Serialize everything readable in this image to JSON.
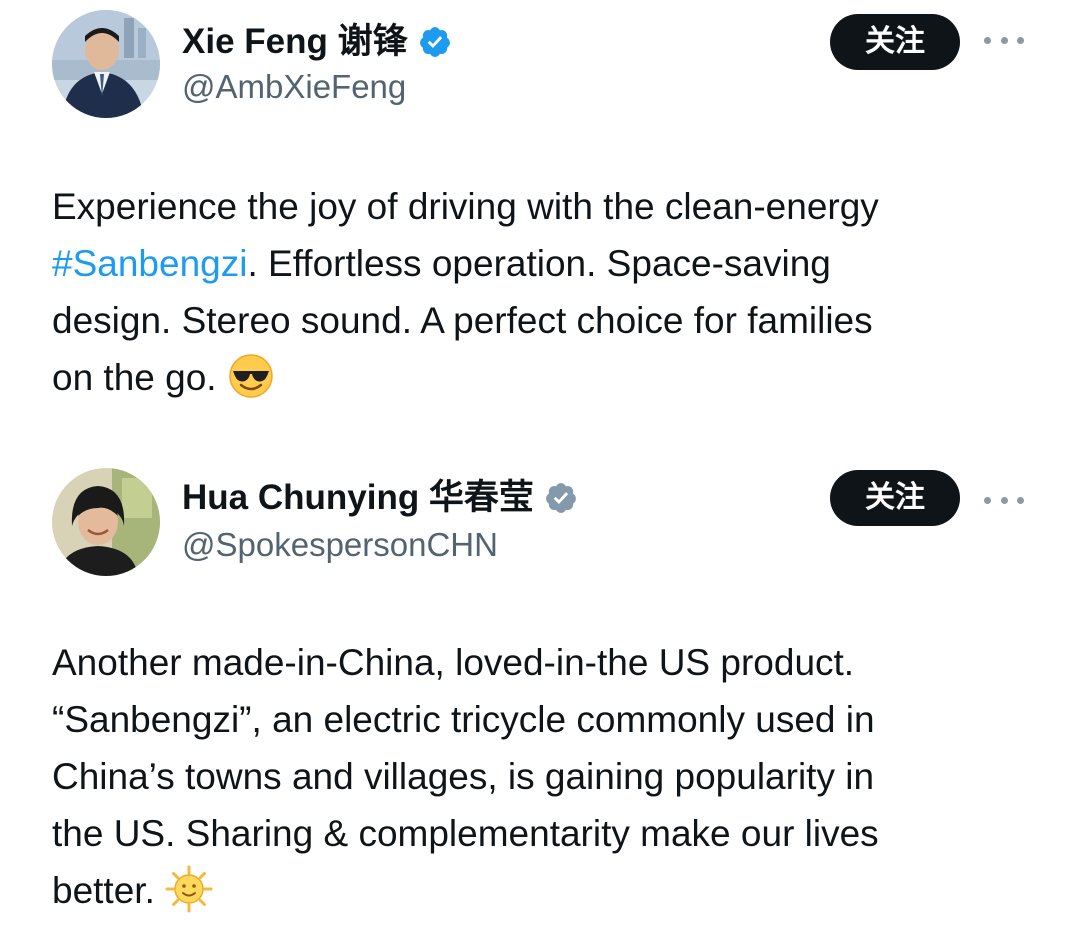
{
  "tweets": [
    {
      "display_name": "Xie Feng 谢锋",
      "handle": "@AmbXieFeng",
      "verified_color": "#1d9bf0",
      "follow_label": "关注",
      "body_lines": [
        "Experience the joy of driving with the clean-energy",
        ". Effortless operation. Space-saving",
        "design. Stereo sound. A perfect choice for families",
        "on the go."
      ],
      "hashtag": "#Sanbengzi",
      "emoji": "smiling-face-with-sunglasses-icon"
    },
    {
      "display_name": "Hua Chunying 华春莹",
      "handle": "@SpokespersonCHN",
      "verified_color": "#829aab",
      "follow_label": "关注",
      "body_lines": [
        "Another made-in-China, loved-in-the US product.",
        "“Sanbengzi”, an electric tricycle commonly used in",
        "China’s towns and villages, is gaining popularity in",
        "the US. Sharing & complementarity make our lives",
        "better."
      ],
      "emoji": "sun-with-face-icon"
    }
  ],
  "colors": {
    "text": "#0f1419",
    "secondary": "#536471",
    "link": "#1d9bf0",
    "button_bg": "#0f1419",
    "button_text": "#ffffff"
  }
}
